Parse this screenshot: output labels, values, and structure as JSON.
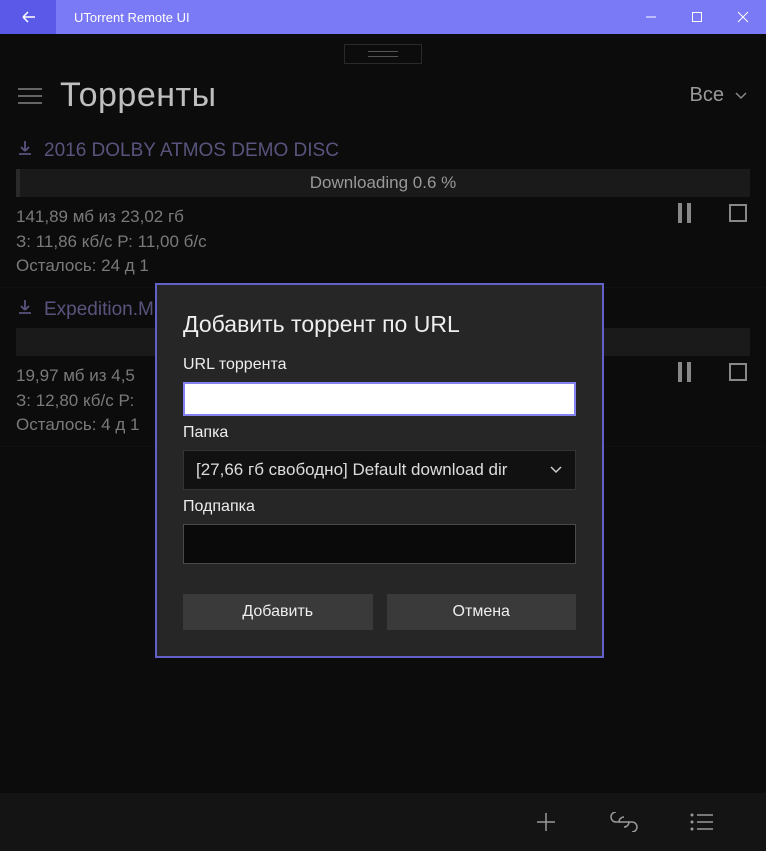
{
  "window": {
    "title": "UTorrent Remote UI"
  },
  "header": {
    "title": "Торренты",
    "filter_label": "Все"
  },
  "torrents": [
    {
      "name": "2016 DOLBY ATMOS DEMO DISC",
      "status": "Downloading 0.6 %",
      "progress_percent": 0.6,
      "size_line": "141,89 мб  из  23,02 гб",
      "speed_line": "З: 11,86 кб/с  Р: 11,00 б/с",
      "eta_line": "Осталось: 24 д 1"
    },
    {
      "name": "Expedition.M",
      "status": "",
      "progress_percent": 0,
      "size_line": "19,97 мб  из  4,5",
      "speed_line": "З: 12,80 кб/с  Р:",
      "eta_line": "Осталось: 4 д 1"
    }
  ],
  "dialog": {
    "title": "Добавить торрент по URL",
    "url_label": "URL торрента",
    "url_value": "",
    "folder_label": "Папка",
    "folder_selected": "[27,66 гб свободно] Default download dir",
    "subfolder_label": "Подпапка",
    "subfolder_value": "",
    "add_button": "Добавить",
    "cancel_button": "Отмена"
  }
}
